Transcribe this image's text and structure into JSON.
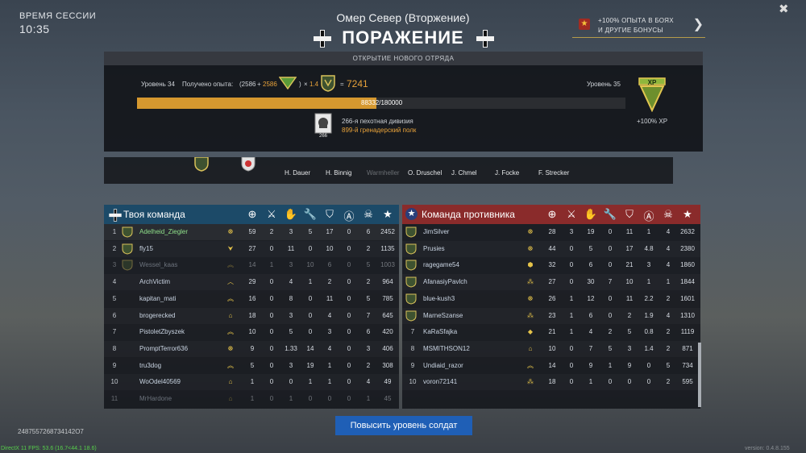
{
  "session": {
    "label": "ВРЕМЯ СЕССИИ",
    "time": "10:35"
  },
  "mission": {
    "title": "Омер Север (Вторжение)",
    "result": "ПОРАЖЕНИЕ"
  },
  "bonus": {
    "line1": "+100% ОПЫТА В БОЯХ",
    "line2": "И ДРУГИЕ БОНУСЫ"
  },
  "panel": {
    "header": "ОТКРЫТИЕ НОВОГО ОТРЯДА",
    "level_current": "Уровень 34",
    "level_next": "Уровень 35",
    "xp_label": "Получено опыта:",
    "xp_base": "(2586",
    "xp_plus": "+",
    "xp_bonus": "2586",
    "xp_close": ")",
    "xp_mult_sign": "×",
    "xp_mult": "1.4",
    "xp_eq": "=",
    "xp_total": "7241",
    "progress_text": "88332/180000",
    "progress_value": 88332,
    "progress_max": 180000,
    "division": "266-я пехотная дивизия",
    "regiment": "899-й гренадерский полк",
    "division_badge": "266",
    "xp_reward": "+100% XP",
    "xp_badge": "XP"
  },
  "soldiers": [
    "H. Dauer",
    "H. Binnig",
    "Warmheller",
    "O. Druschel",
    "J. Chmel",
    "J. Focke",
    "F. Strecker"
  ],
  "columns": [
    "crosshair-icon",
    "kill-icon",
    "hand-icon",
    "wrench-icon",
    "shield-a-icon",
    "circle-a-icon",
    "skull-icon",
    "star-icon"
  ],
  "my_team": {
    "title": "Твоя команда",
    "rows": [
      {
        "n": "1",
        "name": "Adelheid_Ziegler",
        "rank": "☸",
        "stats": [
          "59",
          "2",
          "3",
          "5",
          "17",
          "0",
          "6",
          "2452"
        ]
      },
      {
        "n": "2",
        "name": "fly15",
        "rank": "⮟",
        "stats": [
          "27",
          "0",
          "11",
          "0",
          "10",
          "0",
          "2",
          "1135"
        ]
      },
      {
        "n": "3",
        "name": "Wessel_kaas",
        "rank": "︽",
        "stats": [
          "14",
          "1",
          "3",
          "10",
          "6",
          "0",
          "5",
          "1003"
        ]
      },
      {
        "n": "4",
        "name": "ArchVictim",
        "rank": "︿",
        "stats": [
          "29",
          "0",
          "4",
          "1",
          "2",
          "0",
          "2",
          "964"
        ]
      },
      {
        "n": "5",
        "name": "kapitan_mati",
        "rank": "︽",
        "stats": [
          "16",
          "0",
          "8",
          "0",
          "11",
          "0",
          "5",
          "785"
        ]
      },
      {
        "n": "6",
        "name": "brogerecked",
        "rank": "⌂",
        "stats": [
          "18",
          "0",
          "3",
          "0",
          "4",
          "0",
          "7",
          "645"
        ]
      },
      {
        "n": "7",
        "name": "PistoletZbyszek",
        "rank": "︽",
        "stats": [
          "10",
          "0",
          "5",
          "0",
          "3",
          "0",
          "6",
          "420"
        ]
      },
      {
        "n": "8",
        "name": "PromptTerror636",
        "rank": "☸",
        "stats": [
          "9",
          "0",
          "1.33",
          "14",
          "4",
          "0",
          "3",
          "406"
        ]
      },
      {
        "n": "9",
        "name": "tru3dog",
        "rank": "︽",
        "stats": [
          "5",
          "0",
          "3",
          "19",
          "1",
          "0",
          "2",
          "308"
        ]
      },
      {
        "n": "10",
        "name": "WoOdel40569",
        "rank": "⌂",
        "stats": [
          "1",
          "0",
          "0",
          "1",
          "1",
          "0",
          "4",
          "49"
        ]
      },
      {
        "n": "11",
        "name": "MrHardone",
        "rank": "⌂",
        "stats": [
          "1",
          "0",
          "1",
          "0",
          "0",
          "0",
          "1",
          "45"
        ]
      }
    ]
  },
  "enemy_team": {
    "title": "Команда противника",
    "rows": [
      {
        "n": "1",
        "name": "JimSilver",
        "rank": "☸",
        "stats": [
          "28",
          "3",
          "19",
          "0",
          "11",
          "1",
          "4",
          "2632"
        ]
      },
      {
        "n": "2",
        "name": "Prusies",
        "rank": "☸",
        "stats": [
          "44",
          "0",
          "5",
          "0",
          "17",
          "4.8",
          "4",
          "2380"
        ]
      },
      {
        "n": "3",
        "name": "ragegame54",
        "rank": "⬢",
        "stats": [
          "32",
          "0",
          "6",
          "0",
          "21",
          "3",
          "4",
          "1860"
        ]
      },
      {
        "n": "4",
        "name": "AfanasiyPavlch",
        "rank": "⁂",
        "stats": [
          "27",
          "0",
          "30",
          "7",
          "10",
          "1",
          "1",
          "1844"
        ]
      },
      {
        "n": "5",
        "name": "blue-kush3",
        "rank": "☸",
        "stats": [
          "26",
          "1",
          "12",
          "0",
          "11",
          "2.2",
          "2",
          "1601"
        ]
      },
      {
        "n": "6",
        "name": "MarneSzanse",
        "rank": "⁂",
        "stats": [
          "23",
          "1",
          "6",
          "0",
          "2",
          "1.9",
          "4",
          "1310"
        ]
      },
      {
        "n": "7",
        "name": "KaRaSfajka",
        "rank": "◆",
        "stats": [
          "21",
          "1",
          "4",
          "2",
          "5",
          "0.8",
          "2",
          "1119"
        ]
      },
      {
        "n": "8",
        "name": "MSMITHSON12",
        "rank": "⌂",
        "stats": [
          "10",
          "0",
          "7",
          "5",
          "3",
          "1.4",
          "2",
          "871"
        ]
      },
      {
        "n": "9",
        "name": "Undiaid_razor",
        "rank": "︽",
        "stats": [
          "14",
          "0",
          "9",
          "1",
          "9",
          "0",
          "5",
          "734"
        ]
      },
      {
        "n": "10",
        "name": "voron72141",
        "rank": "⁂",
        "stats": [
          "18",
          "0",
          "1",
          "0",
          "0",
          "0",
          "2",
          "595"
        ]
      }
    ]
  },
  "action_button": "Повысить уровень солдат",
  "footer_id": "2487557268734142О7",
  "fps_text": "DirectX 11 FPS: 53.6 (16.7<44.1 18.6)",
  "version": "version: 0.4.8.155",
  "colors": {
    "my_team": "#1c4a68",
    "enemy_team": "#8a2b2b",
    "accent": "#e8a23a",
    "button": "#1f5fb6"
  }
}
